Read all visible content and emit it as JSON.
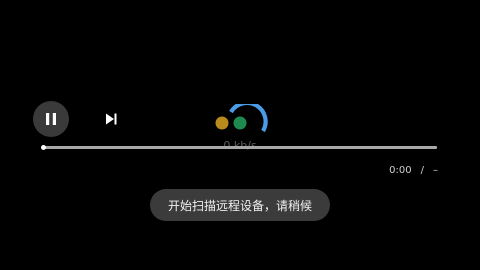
{
  "player": {
    "controls": {
      "pause_icon": "pause-icon",
      "next_icon": "skip-next-icon"
    },
    "loading": {
      "speed_text": "0 kb/s",
      "dot_colors": [
        "#b98a1c",
        "#1e8a4f"
      ],
      "spinner_color": "#4a9be8"
    },
    "progress": {
      "value": 0
    },
    "time": {
      "current": "0:00",
      "separator": "/",
      "duration": "–"
    },
    "toast": {
      "message": "开始扫描远程设备，请稍候"
    }
  }
}
